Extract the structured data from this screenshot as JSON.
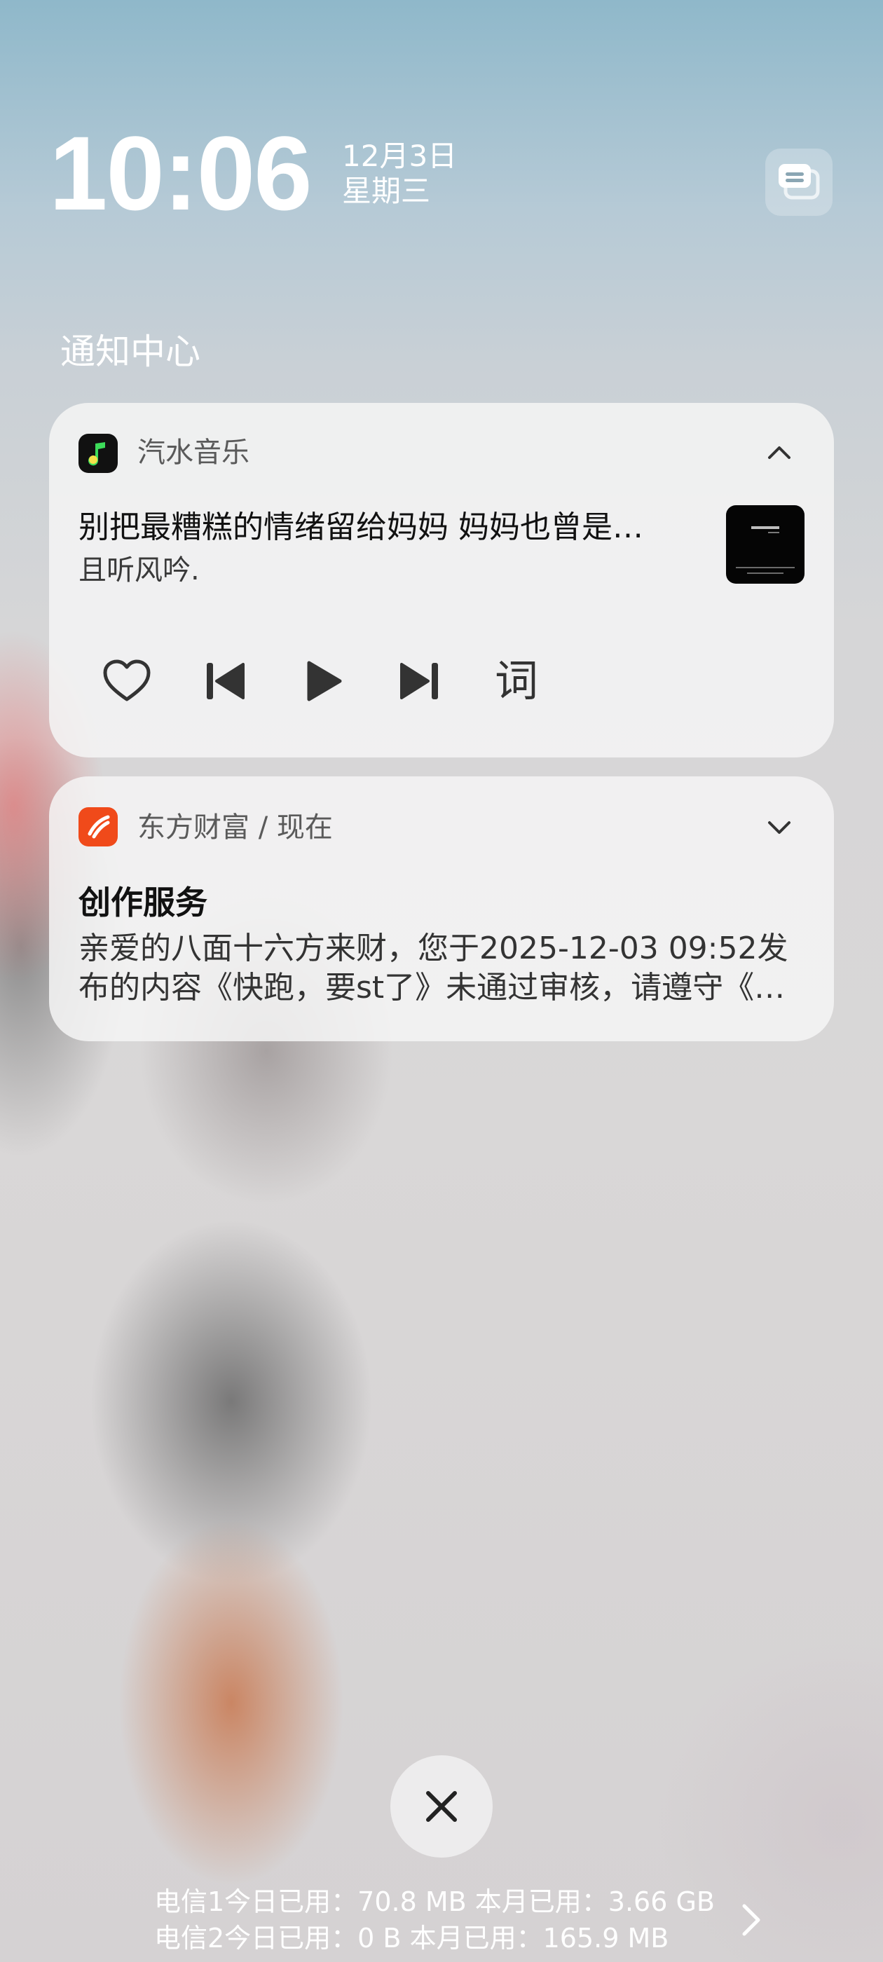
{
  "header": {
    "time": "10:06",
    "date": "12月3日",
    "weekday": "星期三",
    "section_title": "通知中心"
  },
  "music_notification": {
    "app_name": "汽水音乐",
    "app_icon": "music-note-icon",
    "app_icon_color": "#111111",
    "accent": "#3ddc5a",
    "song_title": "别把最糟糕的情绪留给妈妈 妈妈也曾是…",
    "artist": "且听风吟.",
    "controls": [
      "heart-icon",
      "previous-icon",
      "play-icon",
      "next-icon"
    ],
    "lyrics_label": "词"
  },
  "east_notification": {
    "app_name": "东方财富 / 现在",
    "app_icon": "east-money-icon",
    "app_icon_color": "#f04a1a",
    "title": "创作服务",
    "body_line1": "亲爱的八面十六方来财，您于2025-12-03 09:52发",
    "body_line2": "布的内容《快跑，要st了》未通过审核，请遵守《…"
  },
  "data_usage": {
    "line1": "电信1今日已用：70.8 MB  本月已用：3.66 GB",
    "line2": "电信2今日已用：0 B  本月已用：165.9 MB"
  }
}
